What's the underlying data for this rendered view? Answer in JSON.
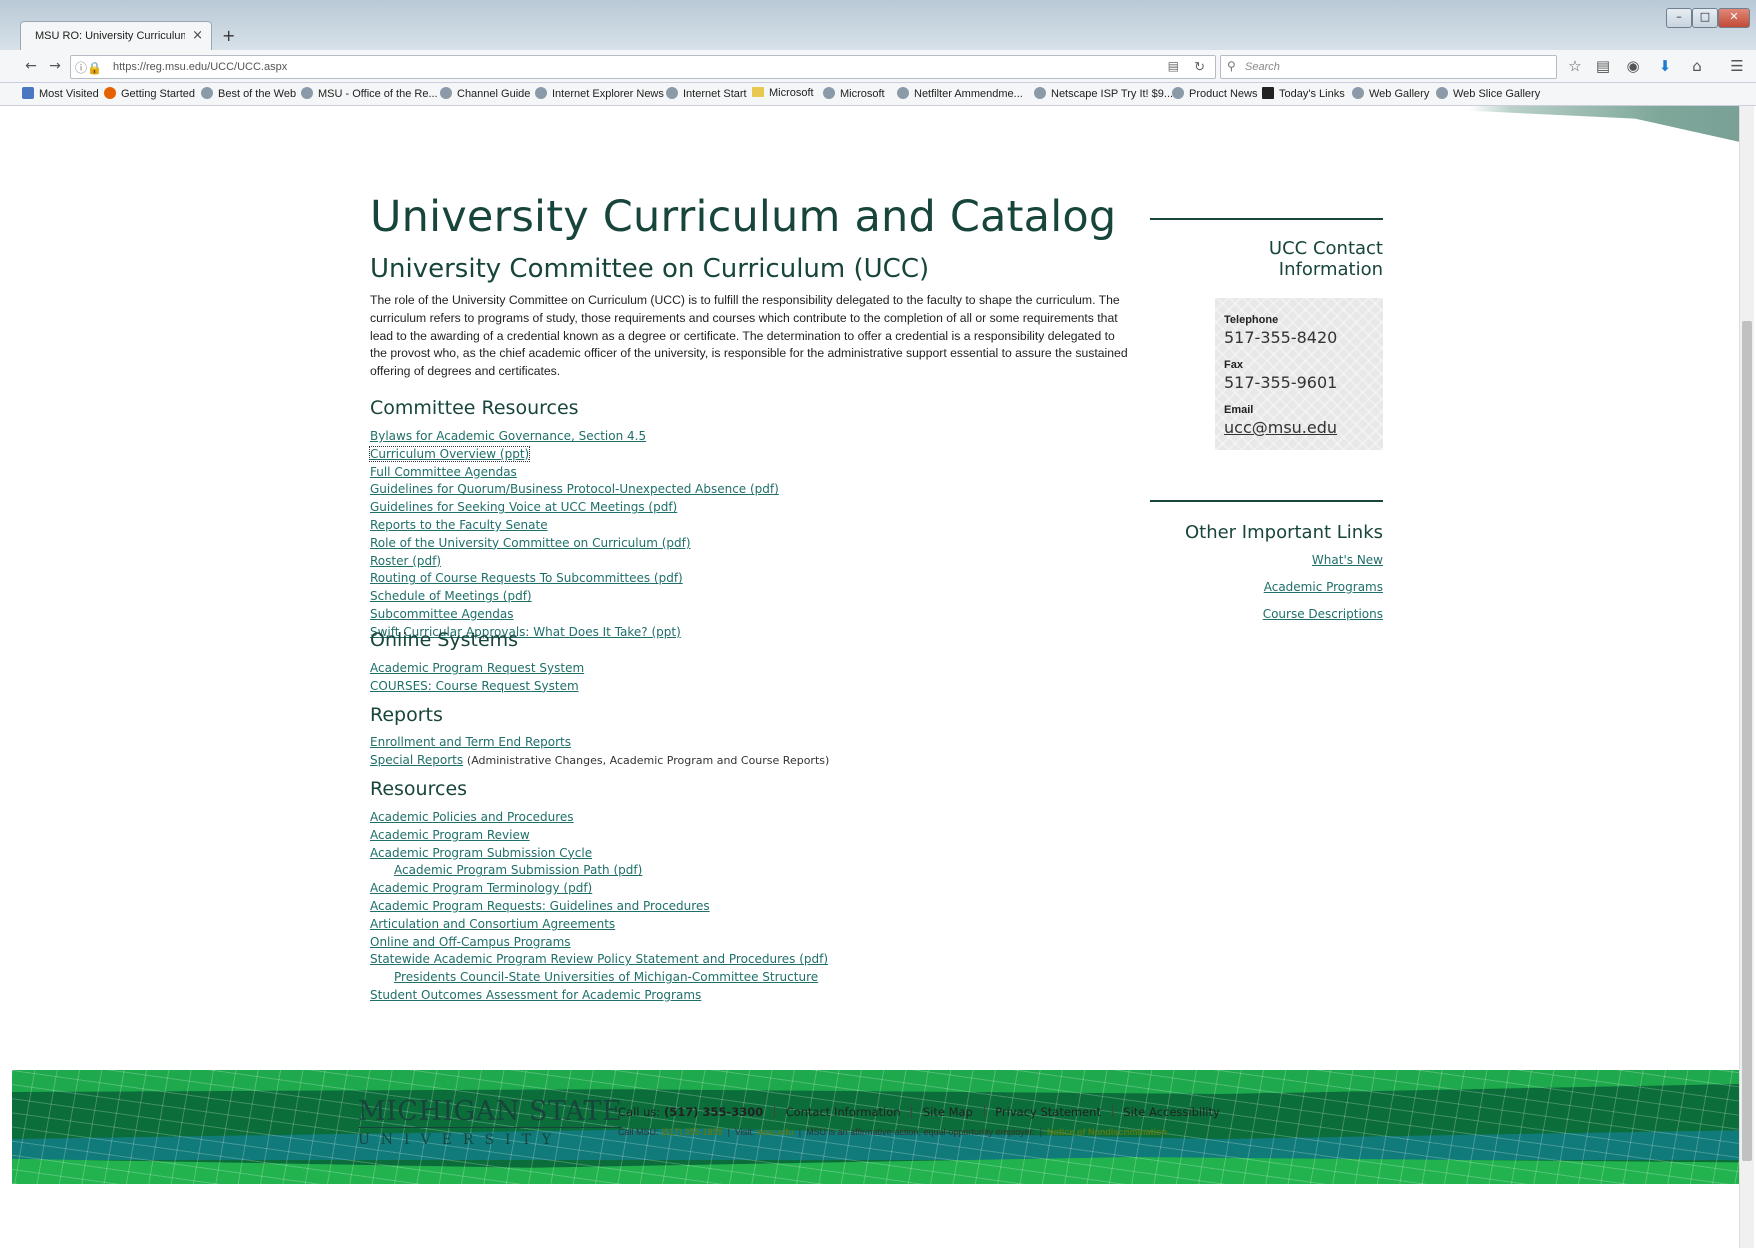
{
  "browser": {
    "tab_title": "MSU RO: University Curriculum and Catalog",
    "new_tab": "+",
    "tab_close": "×",
    "url": "https://reg.msu.edu/UCC/UCC.aspx",
    "search_placeholder": "Search",
    "window_controls": [
      "–",
      "□",
      "✕"
    ],
    "bookmarks": [
      "Most Visited",
      "Getting Started",
      "Best of the Web",
      "MSU - Office of the Re...",
      "Channel Guide",
      "Internet Explorer News",
      "Internet Start",
      "Microsoft",
      "Microsoft",
      "Netfilter Ammendme...",
      "Netscape ISP Try It! $9...",
      "Product News",
      "Today's Links",
      "Web Gallery",
      "Web Slice Gallery"
    ]
  },
  "page": {
    "title": "University Curriculum and Catalog",
    "subtitle": "University Committee on Curriculum (UCC)",
    "intro": "The role of the University Committee on Curriculum (UCC) is to fulfill the responsibility delegated to the faculty to shape the curriculum. The curriculum refers to programs of study, those requirements and courses which contribute to the completion of all or some requirements that lead to the awarding of a credential known as a degree or certificate. The determination to offer a credential is a responsibility delegated to the provost who, as the chief academic officer of the university, is responsible for the administrative support essential to assure the sustained offering of degrees and certificates.",
    "committee_resources": {
      "heading": "Committee Resources",
      "links": [
        "Bylaws for Academic Governance, Section 4.5",
        "Curriculum Overview (ppt)",
        "Full Committee Agendas",
        "Guidelines for Quorum/Business Protocol-Unexpected Absence (pdf)",
        "Guidelines for Seeking Voice at UCC Meetings (pdf)",
        "Reports to the Faculty Senate",
        "Role of the University Committee on Curriculum (pdf)",
        "Roster (pdf)",
        "Routing of Course Requests To Subcommittees (pdf)",
        "Schedule of Meetings (pdf)",
        "Subcommittee Agendas",
        "Swift Curricular Approvals: What Does It Take? (ppt)"
      ]
    },
    "online_systems": {
      "heading": "Online Systems",
      "links": [
        "Academic Program Request System",
        "COURSES: Course Request System"
      ]
    },
    "reports": {
      "heading": "Reports",
      "links": [
        "Enrollment and Term End Reports",
        "Special Reports"
      ],
      "special_note": "(Administrative Changes, Academic Program and Course Reports)"
    },
    "resources": {
      "heading": "Resources",
      "links": [
        "Academic Policies and Procedures",
        "Academic Program Review",
        "Academic Program Submission Cycle",
        "Academic Program Submission Path (pdf)",
        "Academic Program Terminology (pdf)",
        "Academic Program Requests: Guidelines and Procedures",
        "Articulation and Consortium Agreements",
        "Online and Off-Campus Programs",
        "Statewide Academic Program Review Policy Statement and Procedures (pdf)",
        "Presidents Council-State Universities of Michigan-Committee Structure",
        "Student Outcomes Assessment for Academic Programs"
      ]
    },
    "sidebar": {
      "contact_heading_1": "UCC Contact",
      "contact_heading_2": "Information",
      "telephone_label": "Telephone",
      "telephone": "517-355-8420",
      "fax_label": "Fax",
      "fax": "517-355-9601",
      "email_label": "Email",
      "email": "ucc@msu.edu",
      "links_heading": "Other Important Links",
      "links": [
        "What's New",
        "Academic Programs",
        "Course Descriptions"
      ]
    },
    "footer": {
      "logo_line1": "MICHIGAN STATE",
      "logo_line2": "UNIVERSITY",
      "call_us": "Call us:",
      "phone": "(517) 355-3300",
      "nav": [
        "Contact Information",
        "Site Map",
        "Privacy Statement",
        "Site Accessibility"
      ],
      "call_msu": "Call MSU:",
      "msu_phone": "(517) 355-1855",
      "visit": "Visit:",
      "visit_site": "msu.edu",
      "eeo": "MSU is an affirmative-action, equal-opportunity employer.",
      "notice": "Notice of Nondiscrimination"
    }
  }
}
